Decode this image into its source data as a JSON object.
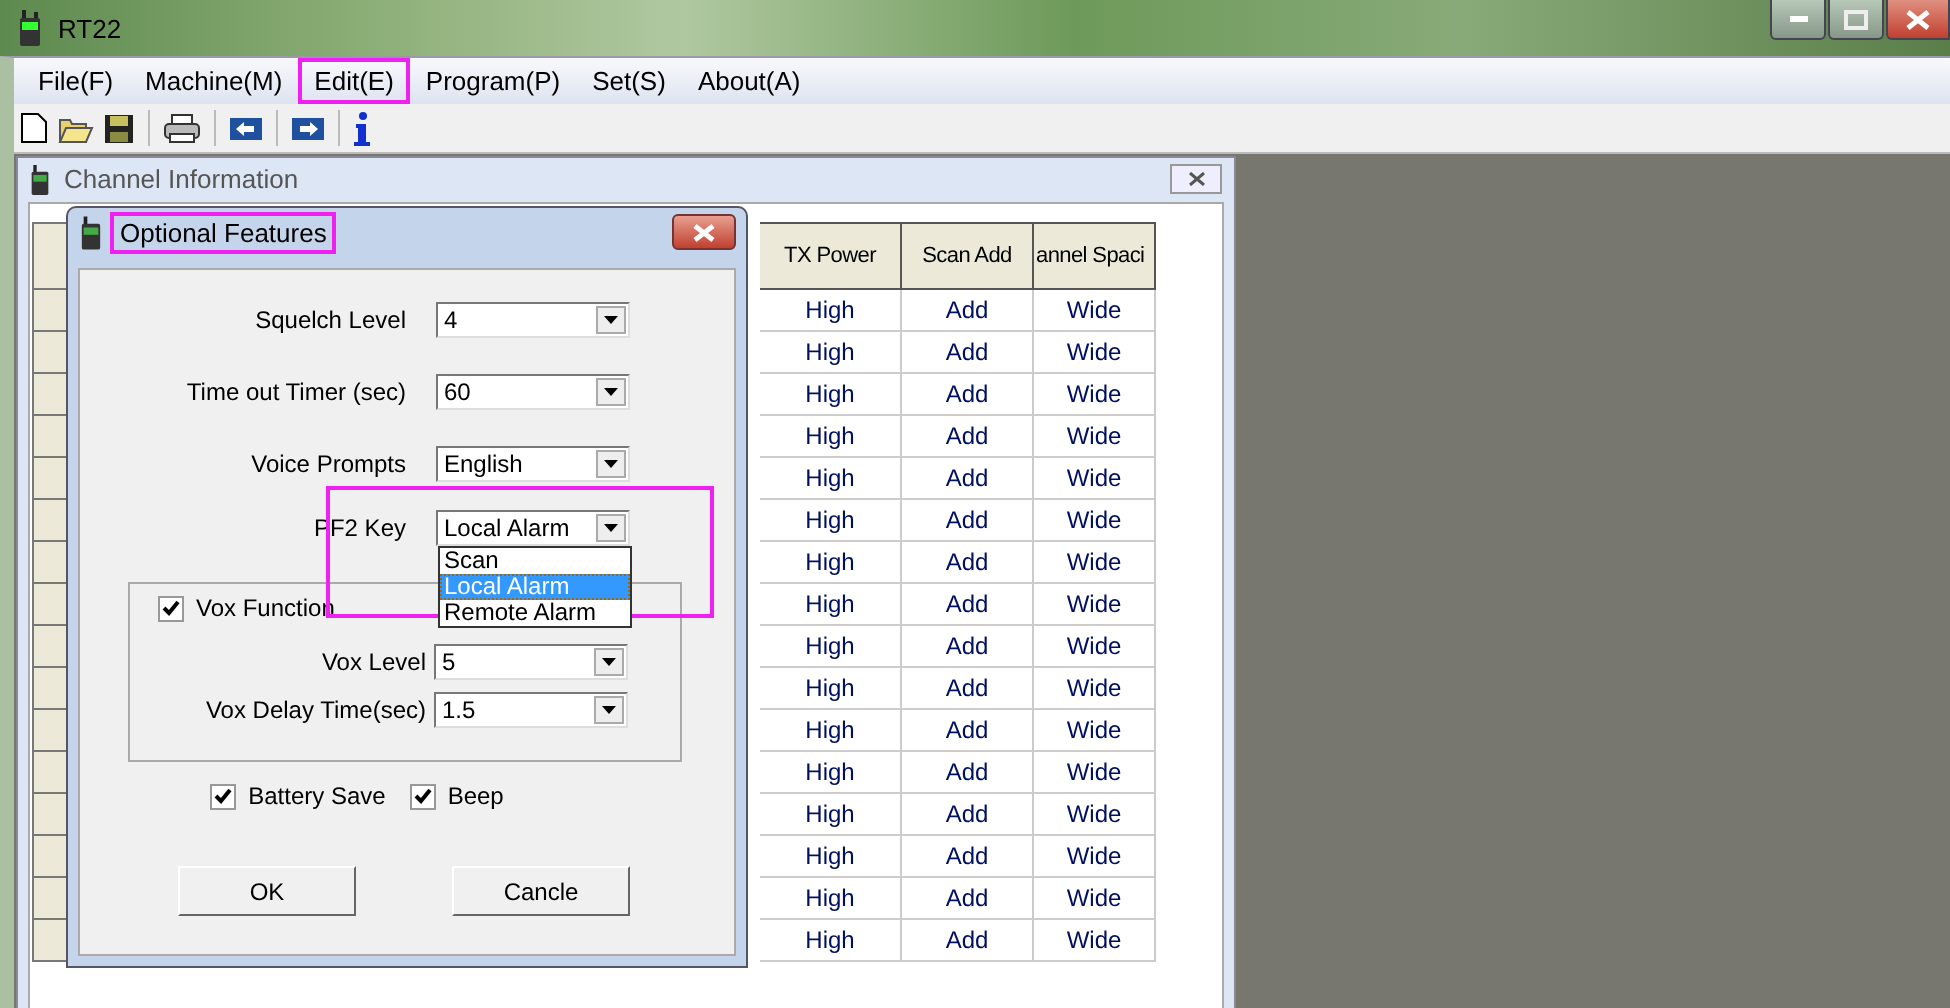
{
  "window": {
    "title": "RT22"
  },
  "menu": [
    {
      "label": "File(F)",
      "annotated": false
    },
    {
      "label": "Machine(M)",
      "annotated": false
    },
    {
      "label": "Edit(E)",
      "annotated": true
    },
    {
      "label": "Program(P)",
      "annotated": false
    },
    {
      "label": "Set(S)",
      "annotated": false
    },
    {
      "label": "About(A)",
      "annotated": false
    }
  ],
  "child_window": {
    "title": "Channel Information",
    "table": {
      "columns": [
        "TX Power",
        "Scan Add",
        "annel Spaci"
      ],
      "rows": [
        [
          "High",
          "Add",
          "Wide"
        ],
        [
          "High",
          "Add",
          "Wide"
        ],
        [
          "High",
          "Add",
          "Wide"
        ],
        [
          "High",
          "Add",
          "Wide"
        ],
        [
          "High",
          "Add",
          "Wide"
        ],
        [
          "High",
          "Add",
          "Wide"
        ],
        [
          "High",
          "Add",
          "Wide"
        ],
        [
          "High",
          "Add",
          "Wide"
        ],
        [
          "High",
          "Add",
          "Wide"
        ],
        [
          "High",
          "Add",
          "Wide"
        ],
        [
          "High",
          "Add",
          "Wide"
        ],
        [
          "High",
          "Add",
          "Wide"
        ],
        [
          "High",
          "Add",
          "Wide"
        ],
        [
          "High",
          "Add",
          "Wide"
        ],
        [
          "High",
          "Add",
          "Wide"
        ],
        [
          "High",
          "Add",
          "Wide"
        ]
      ]
    }
  },
  "dialog": {
    "title": "Optional Features",
    "title_annotated": true,
    "fields": [
      {
        "label": "Squelch Level",
        "value": "4",
        "annotated": false
      },
      {
        "label": "Time out Timer (sec)",
        "value": "60",
        "annotated": false
      },
      {
        "label": "Voice Prompts",
        "value": "English",
        "annotated": false
      },
      {
        "label": "PF2 Key",
        "value": "Local Alarm",
        "annotated": true,
        "options": [
          {
            "label": "Scan",
            "selected": false
          },
          {
            "label": "Local Alarm",
            "selected": true
          },
          {
            "label": "Remote Alarm",
            "selected": false
          }
        ]
      }
    ],
    "vox_group": {
      "checkbox": {
        "label": "Vox Function",
        "checked": true
      },
      "fields": [
        {
          "label": "Vox Level",
          "value": "5"
        },
        {
          "label": "Vox Delay Time(sec)",
          "value": "1.5"
        }
      ]
    },
    "checkboxes": [
      {
        "label": "Battery Save",
        "checked": true
      },
      {
        "label": "Beep",
        "checked": true
      }
    ],
    "buttons": [
      "OK",
      "Cancle"
    ]
  }
}
